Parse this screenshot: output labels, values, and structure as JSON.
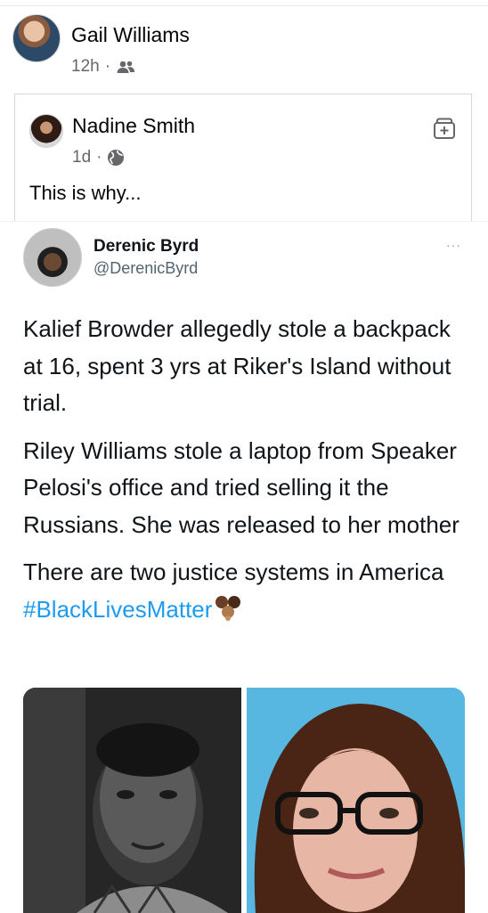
{
  "post": {
    "author": "Gail Williams",
    "time": "12h",
    "separator": "·",
    "audience_icon": "friends-icon"
  },
  "shared_post": {
    "author": "Nadine Smith",
    "time": "1d",
    "separator": "·",
    "audience_icon": "globe-icon",
    "text": "This is why..."
  },
  "tweet": {
    "name": "Derenic Byrd",
    "handle": "@DerenicByrd",
    "more": "···",
    "paragraphs": [
      "Kalief Browder allegedly stole a backpack at 16, spent 3 yrs at Riker's Island without trial.",
      "Riley Williams stole a laptop from Speaker Pelosi's office and tried selling it the Russians. She was released to her mother"
    ],
    "last_paragraph_text": "There are two justice systems in America ",
    "hashtag": "#BlackLivesMatter",
    "emoji": "raised-fists-emoji"
  },
  "colors": {
    "meta_gray": "#65676b",
    "hashtag_blue": "#1d9bf0",
    "photo_bg_right": "#58b7e0"
  }
}
